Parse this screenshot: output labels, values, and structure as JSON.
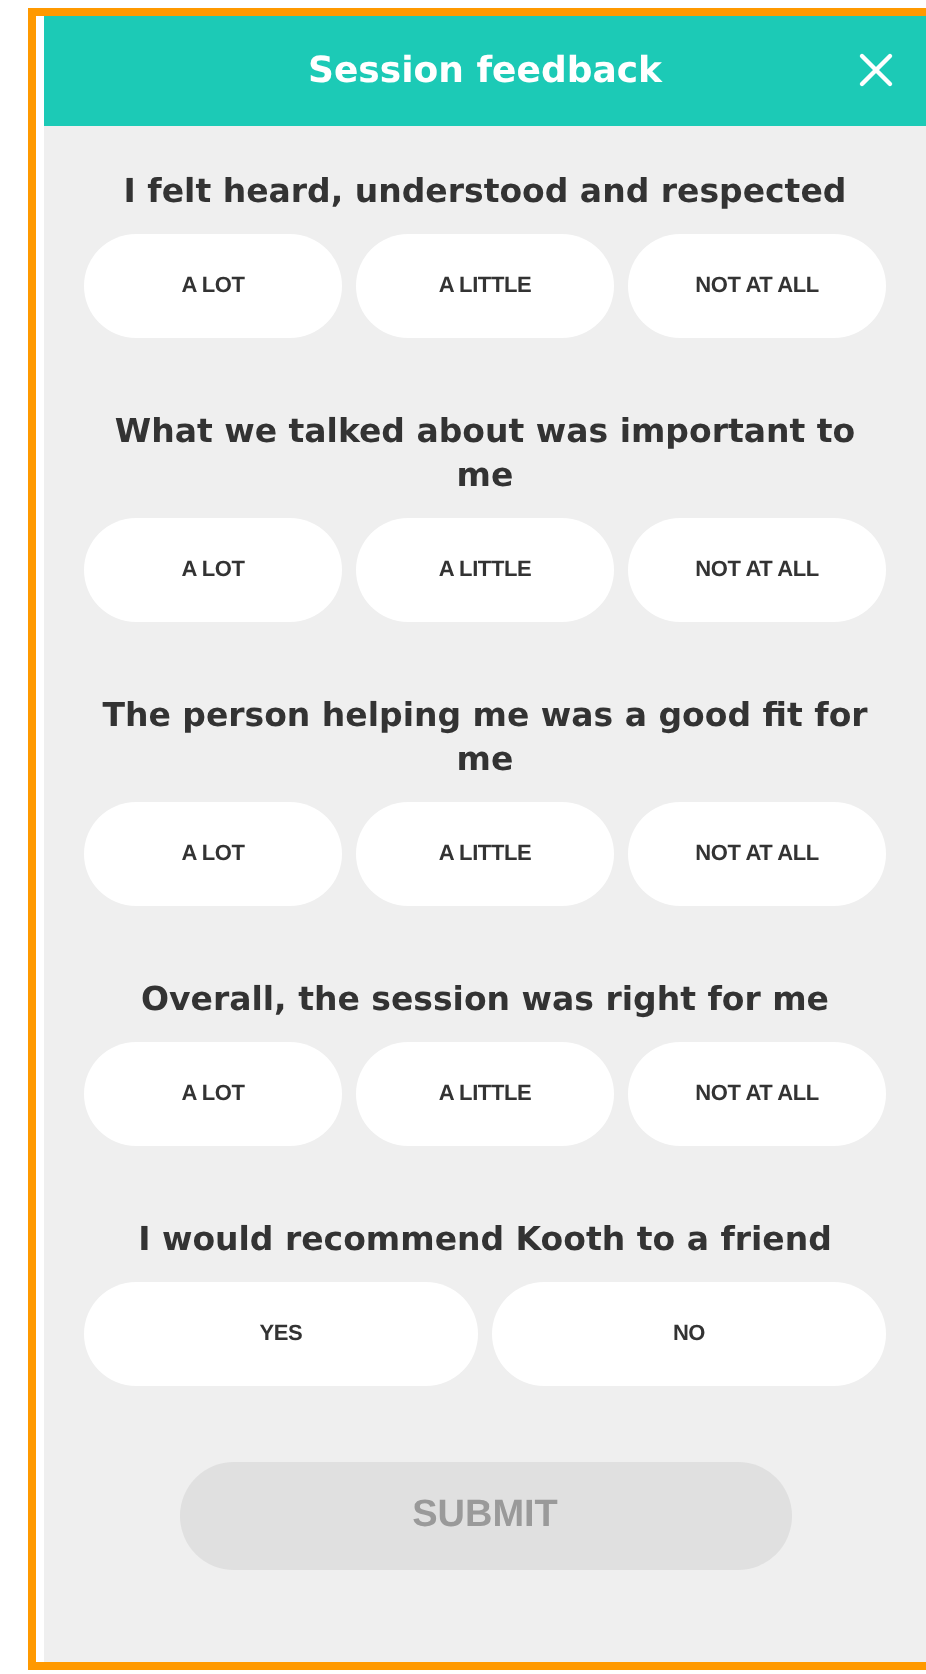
{
  "header": {
    "title": "Session feedback"
  },
  "questions": [
    {
      "text": "I felt heard, understood and respected",
      "options": [
        {
          "label": "A LOT",
          "selected": false
        },
        {
          "label": "A LITTLE",
          "selected": false
        },
        {
          "label": "NOT AT ALL",
          "selected": false
        }
      ]
    },
    {
      "text": "What we talked about was important to me",
      "options": [
        {
          "label": "A LOT",
          "selected": false
        },
        {
          "label": "A LITTLE",
          "selected": false
        },
        {
          "label": "NOT AT ALL",
          "selected": false
        }
      ]
    },
    {
      "text": "The person helping me was a good fit for me",
      "options": [
        {
          "label": "A LOT",
          "selected": false
        },
        {
          "label": "A LITTLE",
          "selected": false
        },
        {
          "label": "NOT AT ALL",
          "selected": false
        }
      ]
    },
    {
      "text": "Overall, the session was right for me",
      "options": [
        {
          "label": "A LOT",
          "selected": false
        },
        {
          "label": "A LITTLE",
          "selected": false
        },
        {
          "label": "NOT AT ALL",
          "selected": false
        }
      ]
    },
    {
      "text": "I would recommend Kooth to a friend",
      "options": [
        {
          "label": "YES",
          "selected": false
        },
        {
          "label": "NO",
          "selected": false
        }
      ]
    }
  ],
  "submit": {
    "label": "SUBMIT",
    "disabled": true
  }
}
